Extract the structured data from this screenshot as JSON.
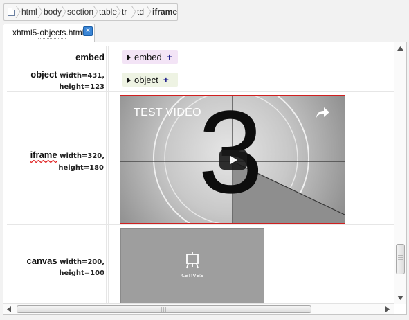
{
  "breadcrumb": {
    "items": [
      "html",
      "body",
      "section",
      "table",
      "tr",
      "td",
      "iframe"
    ]
  },
  "tab": {
    "label": "xhtml5-objects.html",
    "close_glyph": "×"
  },
  "rows": [
    {
      "tag": "embed",
      "attrs": "",
      "content_tag": "embed"
    },
    {
      "tag": "object",
      "attrs_line1": "width=431,",
      "attrs_line2": "height=123",
      "content_tag": "object"
    },
    {
      "tag": "iframe",
      "attrs_line1": "width=320,",
      "attrs_line2": "height=180"
    },
    {
      "tag": "canvas",
      "attrs_line1": "width=200,",
      "attrs_line2": "height=100"
    }
  ],
  "video": {
    "title": "TEST VIDEO",
    "countdown_digit": "3"
  },
  "canvas": {
    "label": "canvas"
  },
  "colors": {
    "embed_tag_bg": "#f3e4f6",
    "object_tag_bg": "#eef3e3",
    "iframe_border": "#d02020",
    "canvas_bg": "#9e9e9e"
  }
}
